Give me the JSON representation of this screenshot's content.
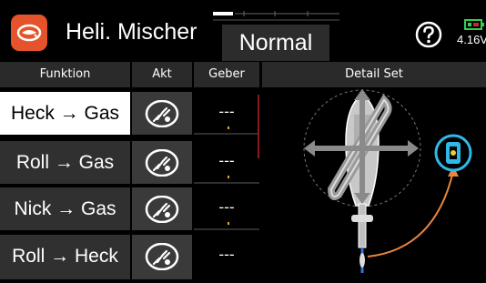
{
  "header": {
    "title": "Heli. Mischer",
    "mode": "Normal",
    "battery_voltage": "4.16V",
    "app_icon": "helicopter-icon",
    "help_icon": "question-circle-icon",
    "battery_icon": "battery-icon",
    "accent_color": "#e4532b"
  },
  "columns": {
    "funktion": "Funktion",
    "akt": "Akt",
    "geber": "Geber",
    "detail": "Detail Set"
  },
  "rows": [
    {
      "function": "Heck → Gas",
      "selected": true,
      "geber": "---"
    },
    {
      "function": "Roll → Gas",
      "selected": false,
      "geber": "---"
    },
    {
      "function": "Nick → Gas",
      "selected": false,
      "geber": "---"
    },
    {
      "function": "Roll → Heck",
      "selected": false,
      "geber": "---"
    }
  ]
}
